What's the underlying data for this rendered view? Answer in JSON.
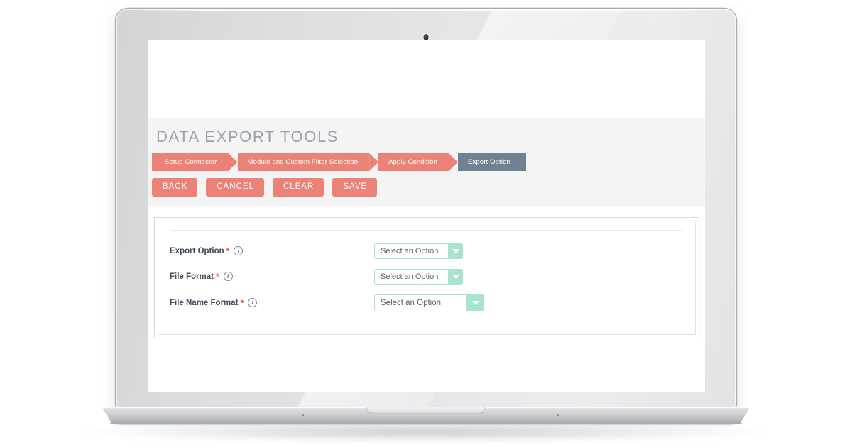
{
  "page": {
    "title": "DATA EXPORT TOOLS"
  },
  "steps": [
    {
      "label": "Setup Connector",
      "state": "done"
    },
    {
      "label": "Module and Custom Filter Selection",
      "state": "done"
    },
    {
      "label": "Apply Condition",
      "state": "done"
    },
    {
      "label": "Export Option",
      "state": "active"
    }
  ],
  "actions": [
    {
      "label": "BACK"
    },
    {
      "label": "CANCEL"
    },
    {
      "label": "CLEAR"
    },
    {
      "label": "SAVE"
    }
  ],
  "form": {
    "fields": [
      {
        "label": "Export Option",
        "required": "*",
        "info": "i",
        "value": "Select an Option",
        "placeholder": "Select an Option"
      },
      {
        "label": "File Format",
        "required": "*",
        "info": "i",
        "value": "Select an Option",
        "placeholder": "Select an Option"
      },
      {
        "label": "File Name Format",
        "required": "*",
        "info": "i",
        "value": "Select an Option",
        "placeholder": "Select an Option"
      }
    ]
  },
  "colors": {
    "accent_coral": "#ec8177",
    "active_step_slate": "#6f8193",
    "select_mint": "#a8e3ce",
    "title_gray": "#9aa1ac",
    "required_red": "#e8453c",
    "header_band": "#f4f4f4"
  }
}
